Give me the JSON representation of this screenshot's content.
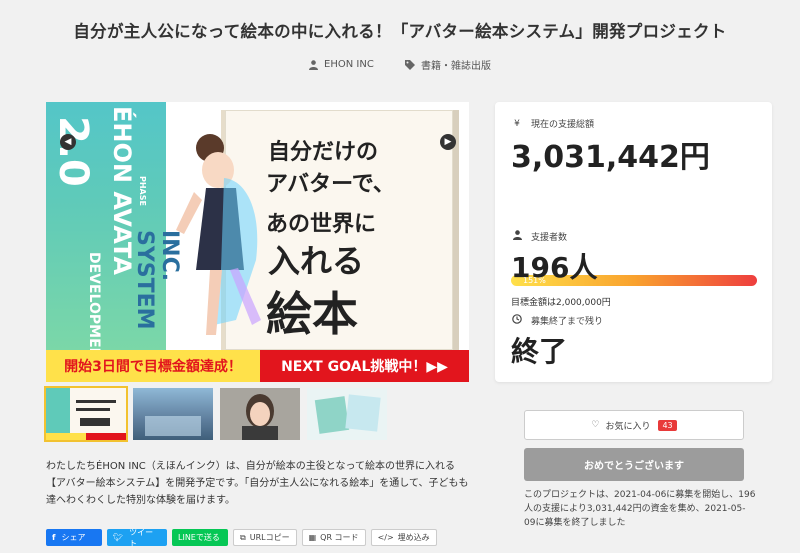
{
  "project": {
    "title": "自分が主人公になって絵本の中に入れる！「アバター絵本システム」開発プロジェクト",
    "owner": "EHON INC",
    "category": "書籍・雑誌出版"
  },
  "hero": {
    "vertical_text_big": "2.0",
    "vertical_text_phase": "PHASE",
    "vertical_text_name": "ÉHON AVATA",
    "vertical_text_sys": "INC. SYSTEM",
    "vertical_text_dev": "DEVELOPMEN",
    "copy_line1": "自分だけの",
    "copy_line2": "アバターで、",
    "copy_line3": "あの世界に",
    "copy_line4": "入れる",
    "copy_line5": "絵本",
    "banner_left": "開始3日間で目標金額達成！",
    "banner_right": "NEXT GOAL挑戦中！▶▶"
  },
  "description": "わたしたちÉHON INC（えほんインク）は、自分が絵本の主役となって絵本の世界に入れる【アバター絵本システム】を開発予定です。「自分が主人公になれる絵本」を通して、子どもも達へわくわくした特別な体験を届けます。",
  "share": {
    "facebook": "シェア",
    "twitter": "ツイート",
    "line": "LINEで送る",
    "url_copy": "URLコピー",
    "qr": "QR コード",
    "embed": "埋め込み"
  },
  "stats": {
    "total_label": "現在の支援総額",
    "total_value": "3,031,442円",
    "percent_label": "151%",
    "percent_value": 151,
    "goal_text": "目標金額は2,000,000円",
    "backers_label": "支援者数",
    "backers_value": "196人",
    "remaining_label": "募集終了まで残り",
    "remaining_value": "終了"
  },
  "actions": {
    "favorite_label": "お気に入り",
    "favorite_count": "43",
    "congrats_label": "おめでとうございます",
    "end_note": "このプロジェクトは、2021-04-06に募集を開始し、196人の支援により3,031,442円の資金を集め、2021-05-09に募集を終了しました"
  },
  "icons": {
    "owner": "user-icon",
    "category": "tag-icon",
    "total": "yen-icon",
    "backers": "user-icon",
    "remaining": "clock-icon",
    "favorite": "heart-icon",
    "prev": "chevron-left-icon",
    "next": "chevron-right-icon"
  },
  "colors": {
    "progress_start": "#ffe04a",
    "progress_end": "#ee3e3e",
    "banner_yellow": "#ffe14a",
    "banner_red": "#e2151d",
    "favorite_badge": "#e83a3a",
    "congrats_button": "#9c9c9c"
  }
}
